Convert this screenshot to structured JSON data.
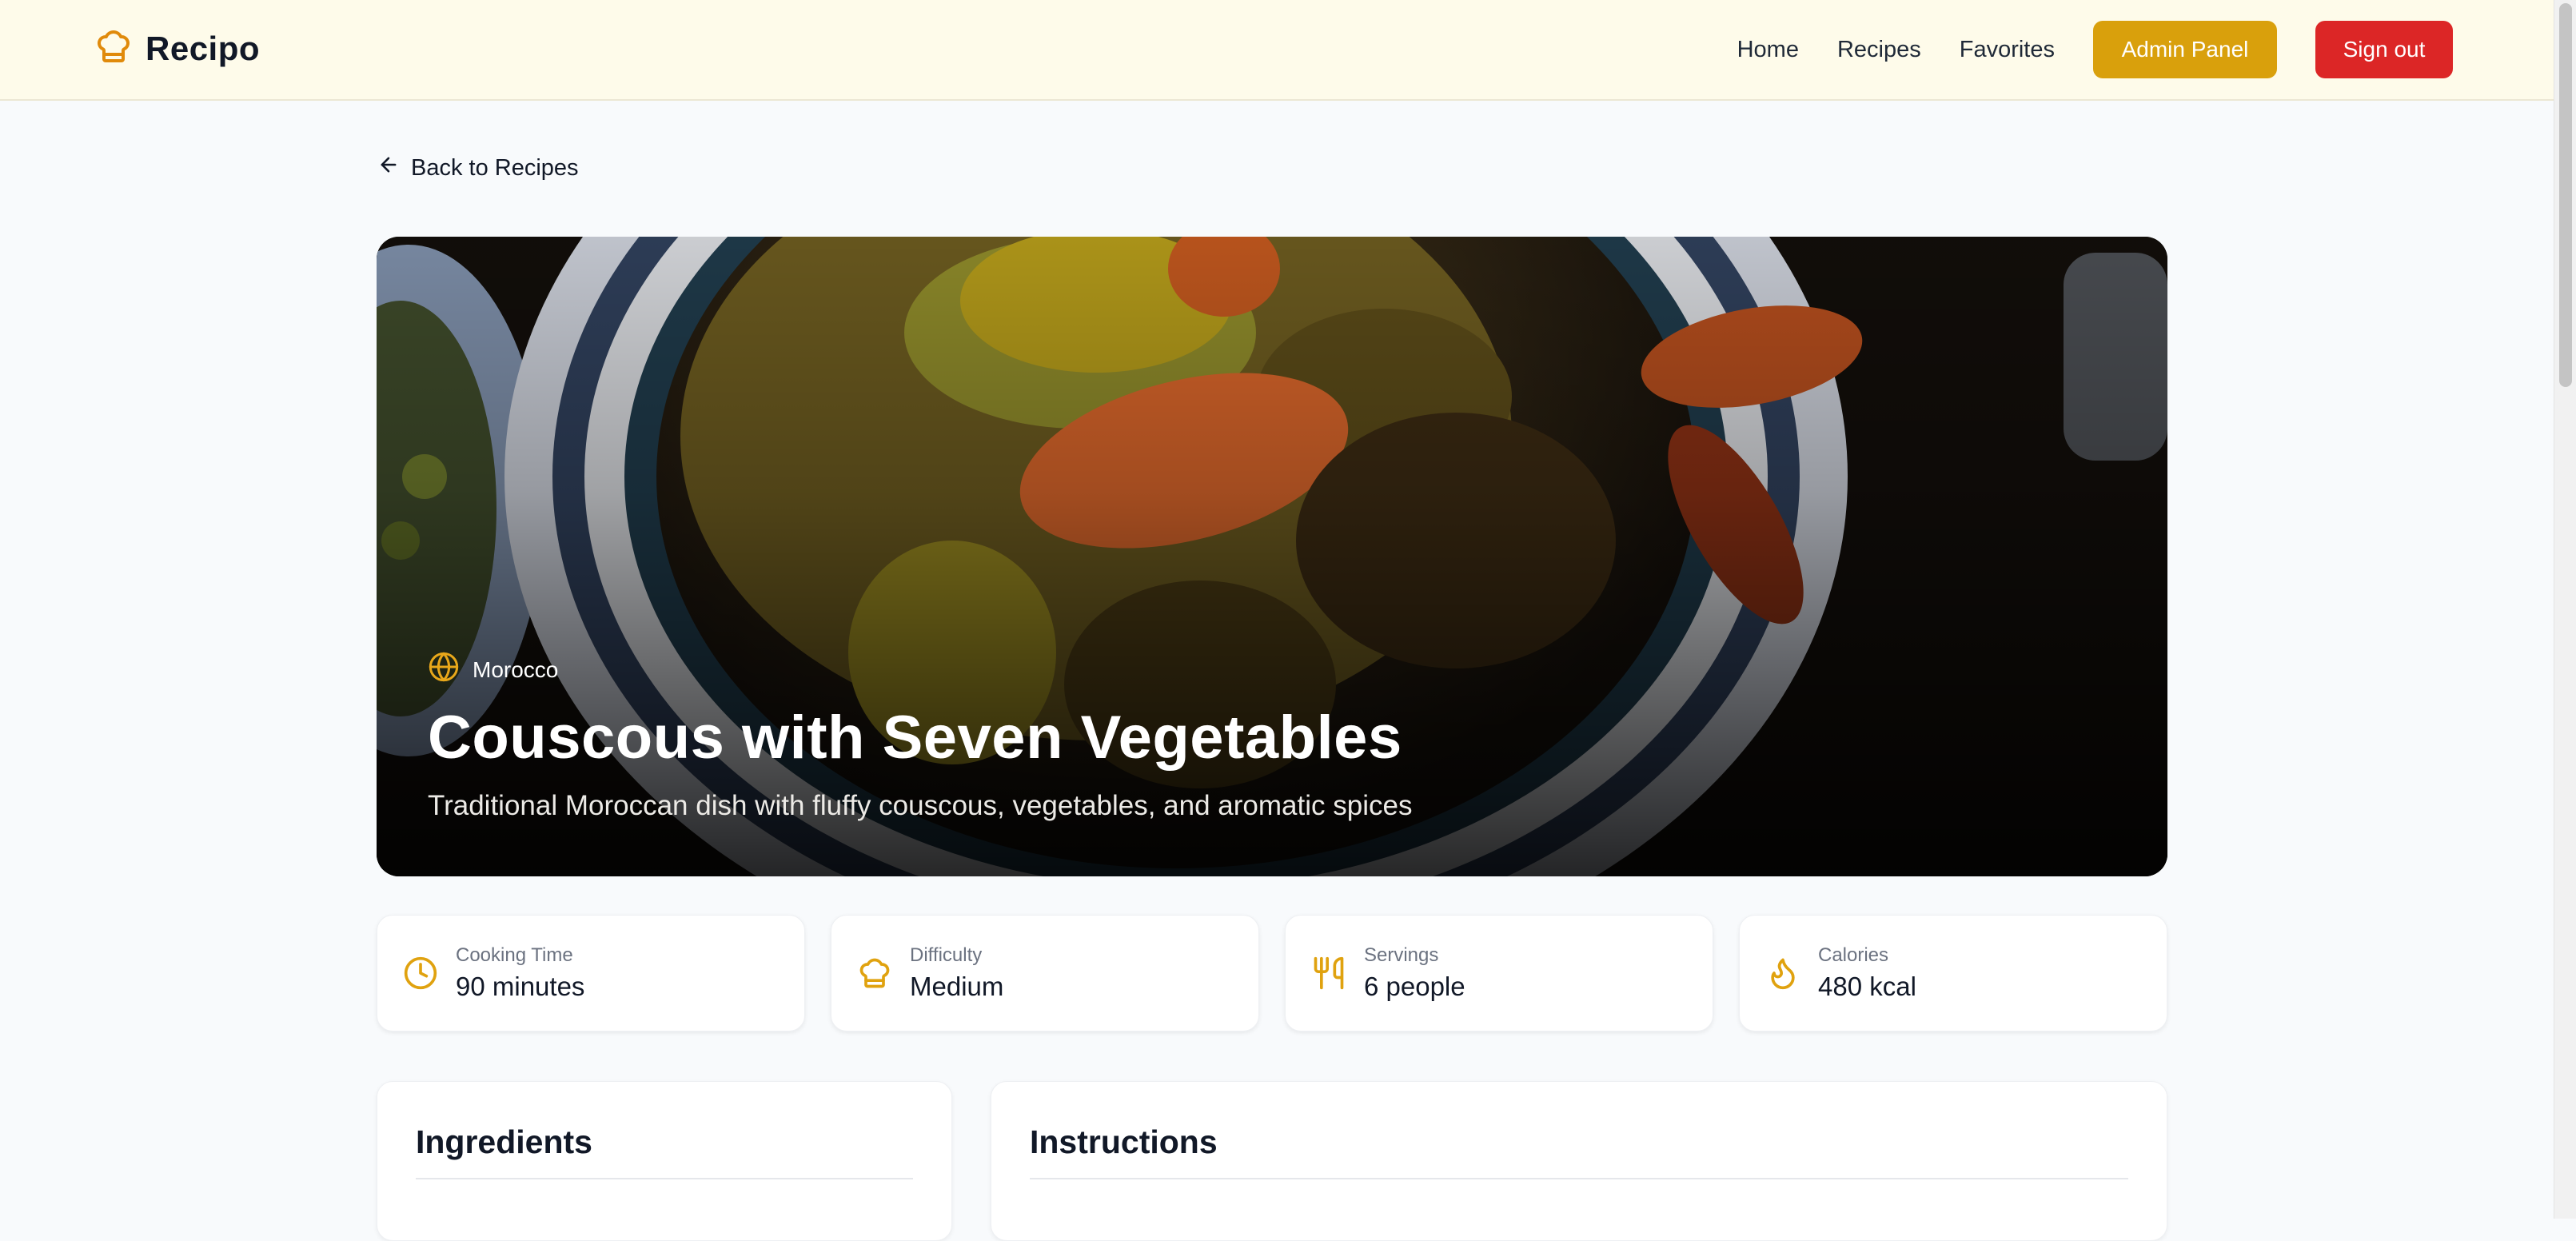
{
  "header": {
    "brand_name": "Recipo",
    "brand_icon": "chef-hat-icon",
    "nav": {
      "home": "Home",
      "recipes": "Recipes",
      "favorites": "Favorites"
    },
    "admin_label": "Admin Panel",
    "signout_label": "Sign out",
    "colors": {
      "header_bg": "#fefbea",
      "admin_bg": "#d9a00c",
      "signout_bg": "#dc2626"
    }
  },
  "back_link": {
    "label": "Back to Recipes",
    "icon": "arrow-left-icon"
  },
  "hero": {
    "origin": "Morocco",
    "origin_icon": "globe-icon",
    "title": "Couscous with Seven Vegetables",
    "description": "Traditional Moroccan dish with fluffy couscous, vegetables, and aromatic spices"
  },
  "stats": [
    {
      "label": "Cooking Time",
      "value": "90 minutes",
      "icon": "clock-icon"
    },
    {
      "label": "Difficulty",
      "value": "Medium",
      "icon": "chef-hat-icon"
    },
    {
      "label": "Servings",
      "value": "6 people",
      "icon": "utensils-icon"
    },
    {
      "label": "Calories",
      "value": "480 kcal",
      "icon": "flame-icon"
    }
  ],
  "sections": {
    "ingredients_title": "Ingredients",
    "instructions_title": "Instructions"
  },
  "accent_color": "#e0a20f"
}
